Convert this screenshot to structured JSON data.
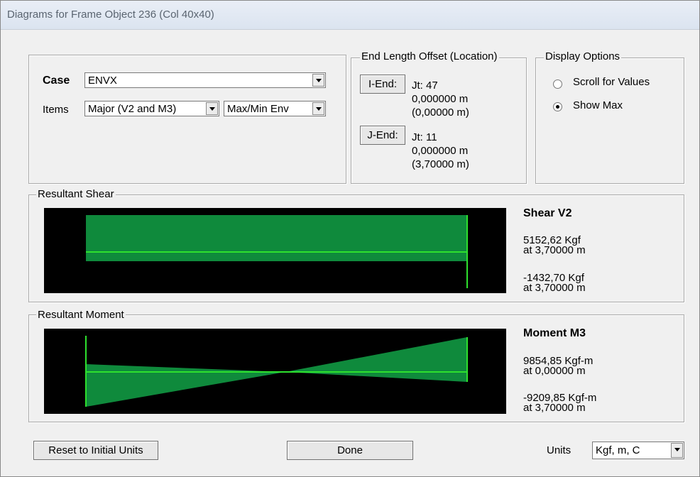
{
  "window": {
    "title": "Diagrams for Frame Object 236  (Col 40x40)"
  },
  "case": {
    "label": "Case",
    "value": "ENVX"
  },
  "items": {
    "label": "Items",
    "component": "Major (V2 and M3)",
    "envelope": "Max/Min Env"
  },
  "offset": {
    "legend": "End Length Offset (Location)",
    "i_end": {
      "button": "I-End:",
      "joint": "Jt:  47",
      "length": "0,000000 m",
      "location": "(0,00000 m)"
    },
    "j_end": {
      "button": "J-End:",
      "joint": "Jt:  11",
      "length": "0,000000 m",
      "location": "(3,70000 m)"
    }
  },
  "display": {
    "legend": "Display Options",
    "options": [
      {
        "label": "Scroll for Values",
        "selected": false
      },
      {
        "label": "Show Max",
        "selected": true
      }
    ]
  },
  "shear": {
    "legend": "Resultant Shear",
    "title": "Shear V2",
    "max_value": "5152,62 Kgf",
    "max_at": "at 3,70000 m",
    "min_value": "-1432,70 Kgf",
    "min_at": "at 3,70000 m",
    "fill_color": "#0f8a3c",
    "line_color": "#2ee02e"
  },
  "moment": {
    "legend": "Resultant Moment",
    "title": "Moment M3",
    "max_value": "9854,85 Kgf-m",
    "max_at": "at 0,00000 m",
    "min_value": "-9209,85 Kgf-m",
    "min_at": "at 3,70000 m",
    "fill_color": "#0f8a3c",
    "line_color": "#2ee02e"
  },
  "footer": {
    "reset_label": "Reset to Initial Units",
    "done_label": "Done",
    "units_label": "Units",
    "units_value": "Kgf, m, C"
  }
}
